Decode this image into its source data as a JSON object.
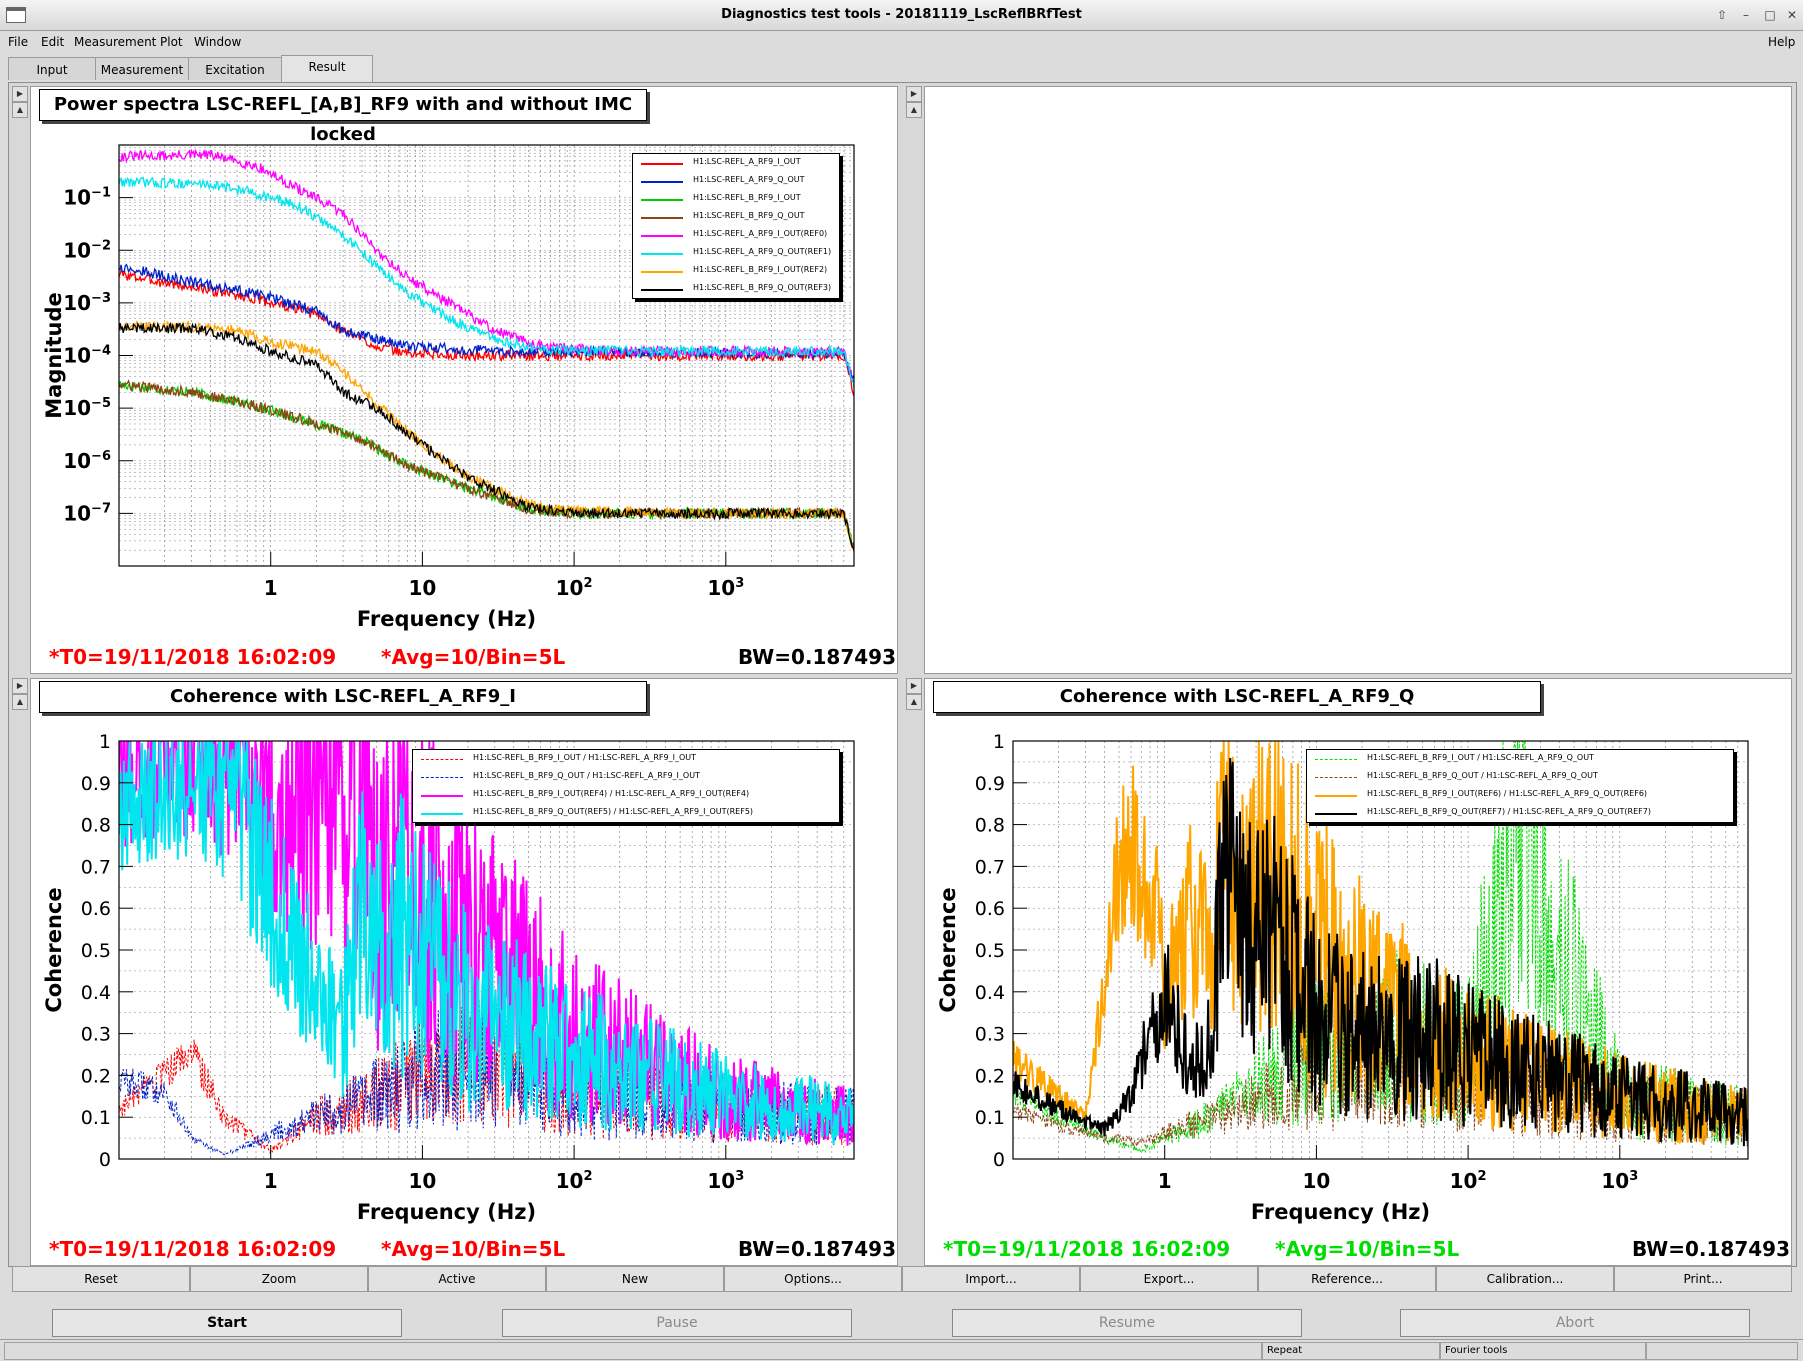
{
  "window": {
    "title": "Diagnostics test tools - 20181119_LscReflBRfTest"
  },
  "menu": {
    "file": "File",
    "edit": "Edit",
    "measurement": "Measurement",
    "plot": "Plot",
    "window": "Window",
    "help": "Help"
  },
  "tabs": [
    "Input",
    "Measurement",
    "Excitation",
    "Result"
  ],
  "active_tab": "Result",
  "pads": {
    "psd": {
      "title": "Power spectra LSC-REFL_[A,B]_RF9 with and without IMC locked",
      "xlabel": "Frequency (Hz)",
      "ylabel": "Magnitude",
      "t0": "*T0=19/11/2018 16:02:09",
      "avg": "*Avg=10/Bin=5L",
      "bw": "BW=0.187493",
      "stat_color": "#ff0000"
    },
    "coh_i": {
      "title": "Coherence with LSC-REFL_A_RF9_I",
      "xlabel": "Frequency (Hz)",
      "ylabel": "Coherence",
      "t0": "*T0=19/11/2018 16:02:09",
      "avg": "*Avg=10/Bin=5L",
      "bw": "BW=0.187493",
      "stat_color": "#ff0000"
    },
    "coh_q": {
      "title": "Coherence with LSC-REFL_A_RF9_Q",
      "xlabel": "Frequency (Hz)",
      "ylabel": "Coherence",
      "t0": "*T0=19/11/2018 16:02:09",
      "avg": "*Avg=10/Bin=5L",
      "bw": "BW=0.187493",
      "stat_color": "#00dd00"
    }
  },
  "chart_data": [
    {
      "type": "line",
      "title": "Power spectra LSC-REFL_[A,B]_RF9 with and without IMC locked",
      "xlabel": "Frequency (Hz)",
      "ylabel": "Magnitude",
      "xscale": "log",
      "yscale": "log",
      "xlim": [
        0.1,
        7000
      ],
      "ylim": [
        1e-08,
        1
      ],
      "xticks": [
        "1",
        "10",
        "10^2",
        "10^3"
      ],
      "yticks": [
        "10^-7",
        "10^-6",
        "10^-5",
        "10^-4",
        "10^-3",
        "10^-2",
        "10^-1"
      ],
      "grid": true,
      "legend_position": "top-right",
      "series": [
        {
          "name": "H1:LSC-REFL_A_RF9_I_OUT",
          "color": "#ff0000",
          "dash": false,
          "x": [
            0.1,
            0.3,
            0.8,
            2,
            3,
            5,
            8,
            20,
            50,
            100,
            1000,
            6000,
            7000
          ],
          "y": [
            0.0035,
            0.002,
            0.0012,
            0.0006,
            0.0003,
            0.00015,
            0.00011,
            0.0001,
            0.0001,
            0.0001,
            0.0001,
            0.0001,
            2e-05
          ]
        },
        {
          "name": "H1:LSC-REFL_A_RF9_Q_OUT",
          "color": "#0022cc",
          "dash": false,
          "x": [
            0.1,
            0.3,
            0.8,
            2,
            3,
            5,
            8,
            20,
            50,
            100,
            1000,
            6000,
            7000
          ],
          "y": [
            0.005,
            0.0025,
            0.0015,
            0.0007,
            0.0003,
            0.0002,
            0.00015,
            0.00013,
            0.00012,
            0.00012,
            0.00011,
            0.00011,
            3e-05
          ]
        },
        {
          "name": "H1:LSC-REFL_B_RF9_I_OUT",
          "color": "#00cc00",
          "dash": false,
          "x": [
            0.1,
            0.3,
            0.8,
            2,
            4,
            8,
            20,
            50,
            100,
            1000,
            6000,
            7000
          ],
          "y": [
            2.8e-05,
            2e-05,
            1.1e-05,
            5e-06,
            2.5e-06,
            8e-07,
            3e-07,
            1.2e-07,
            1e-07,
            1e-07,
            1e-07,
            2e-08
          ]
        },
        {
          "name": "H1:LSC-REFL_B_RF9_Q_OUT",
          "color": "#8b4513",
          "dash": false,
          "x": [
            0.1,
            0.3,
            0.8,
            2,
            4,
            8,
            20,
            50,
            100,
            1000,
            6000,
            7000
          ],
          "y": [
            2.8e-05,
            2e-05,
            1.1e-05,
            5e-06,
            2.5e-06,
            8e-07,
            3e-07,
            1.2e-07,
            1e-07,
            1e-07,
            1e-07,
            2e-08
          ]
        },
        {
          "name": "H1:LSC-REFL_A_RF9_I_OUT(REF0)",
          "color": "#ff00ff",
          "dash": false,
          "x": [
            0.1,
            0.4,
            0.8,
            1.5,
            3,
            5,
            8,
            15,
            30,
            60,
            200,
            1000,
            6000,
            7000
          ],
          "y": [
            0.6,
            0.65,
            0.4,
            0.15,
            0.05,
            0.01,
            0.003,
            0.001,
            0.0003,
            0.00015,
            0.00012,
            0.00012,
            0.00012,
            3e-05
          ]
        },
        {
          "name": "H1:LSC-REFL_A_RF9_Q_OUT(REF1)",
          "color": "#00e5ee",
          "dash": false,
          "x": [
            0.1,
            0.4,
            0.8,
            1.5,
            3,
            5,
            8,
            15,
            30,
            60,
            200,
            1000,
            6000,
            7000
          ],
          "y": [
            0.2,
            0.18,
            0.12,
            0.07,
            0.02,
            0.005,
            0.0015,
            0.0005,
            0.0002,
            0.00013,
            0.00012,
            0.00012,
            0.00012,
            3e-05
          ]
        },
        {
          "name": "H1:LSC-REFL_B_RF9_I_OUT(REF2)",
          "color": "#ffa500",
          "dash": false,
          "x": [
            0.1,
            0.3,
            0.6,
            1,
            2,
            3,
            5,
            10,
            20,
            50,
            100,
            1000,
            6000,
            7000
          ],
          "y": [
            0.00035,
            0.00035,
            0.0003,
            0.00018,
            0.00012,
            5e-05,
            1.2e-05,
            2e-06,
            5e-07,
            1.5e-07,
            1.1e-07,
            1e-07,
            1e-07,
            2e-08
          ]
        },
        {
          "name": "H1:LSC-REFL_B_RF9_Q_OUT(REF3)",
          "color": "#000000",
          "dash": false,
          "x": [
            0.1,
            0.3,
            0.6,
            1,
            2,
            3,
            5,
            10,
            20,
            50,
            100,
            1000,
            6000,
            7000
          ],
          "y": [
            0.00033,
            0.00033,
            0.00022,
            0.00012,
            7e-05,
            2e-05,
            1e-05,
            2e-06,
            5e-07,
            1.3e-07,
            1e-07,
            1e-07,
            1e-07,
            2e-08
          ]
        }
      ]
    },
    {
      "type": "line",
      "title": "Coherence with LSC-REFL_A_RF9_I",
      "xlabel": "Frequency (Hz)",
      "ylabel": "Coherence",
      "xscale": "log",
      "xlim": [
        0.1,
        7000
      ],
      "ylim": [
        0,
        1
      ],
      "yticks": [
        "0",
        "0.1",
        "0.2",
        "0.3",
        "0.4",
        "0.5",
        "0.6",
        "0.7",
        "0.8",
        "0.9",
        "1"
      ],
      "xticks": [
        "1",
        "10",
        "10^2",
        "10^3"
      ],
      "grid": true,
      "legend_position": "top-right",
      "series": [
        {
          "name": "H1:LSC-REFL_B_RF9_I_OUT / H1:LSC-REFL_A_RF9_I_OUT",
          "color": "#ff0000",
          "dash": true,
          "x": [
            0.1,
            0.2,
            0.3,
            0.5,
            1,
            2,
            5,
            10,
            30,
            100,
            1000,
            7000
          ],
          "y": [
            0.12,
            0.2,
            0.26,
            0.1,
            0.02,
            0.1,
            0.15,
            0.2,
            0.25,
            0.15,
            0.12,
            0.1
          ]
        },
        {
          "name": "H1:LSC-REFL_B_RF9_Q_OUT / H1:LSC-REFL_A_RF9_I_OUT",
          "color": "#0022cc",
          "dash": true,
          "x": [
            0.1,
            0.2,
            0.3,
            0.5,
            1,
            2,
            5,
            10,
            30,
            100,
            1000,
            7000
          ],
          "y": [
            0.19,
            0.16,
            0.05,
            0.01,
            0.06,
            0.1,
            0.15,
            0.2,
            0.25,
            0.15,
            0.12,
            0.1
          ]
        },
        {
          "name": "H1:LSC-REFL_B_RF9_I_OUT(REF4) / H1:LSC-REFL_A_RF9_I_OUT(REF4)",
          "color": "#ff00ff",
          "dash": false,
          "x": [
            0.1,
            0.2,
            0.4,
            0.6,
            0.8,
            1,
            1.5,
            2,
            3,
            4,
            5,
            8,
            10,
            20,
            50,
            100,
            1000,
            7000
          ],
          "y": [
            0.92,
            0.93,
            0.97,
            0.96,
            0.9,
            0.85,
            0.8,
            0.9,
            0.75,
            0.95,
            0.6,
            0.8,
            0.7,
            0.5,
            0.4,
            0.3,
            0.15,
            0.1
          ]
        },
        {
          "name": "H1:LSC-REFL_B_RF9_Q_OUT(REF5) / H1:LSC-REFL_A_RF9_I_OUT(REF5)",
          "color": "#00e5ee",
          "dash": false,
          "x": [
            0.1,
            0.2,
            0.4,
            0.6,
            0.8,
            1,
            1.5,
            2,
            3,
            4,
            5,
            8,
            10,
            20,
            50,
            100,
            1000,
            7000
          ],
          "y": [
            0.85,
            0.88,
            0.92,
            0.85,
            0.75,
            0.65,
            0.5,
            0.4,
            0.3,
            0.6,
            0.5,
            0.55,
            0.45,
            0.35,
            0.3,
            0.25,
            0.15,
            0.1
          ]
        }
      ]
    },
    {
      "type": "line",
      "title": "Coherence with LSC-REFL_A_RF9_Q",
      "xlabel": "Frequency (Hz)",
      "ylabel": "Coherence",
      "xscale": "log",
      "xlim": [
        0.1,
        7000
      ],
      "ylim": [
        0,
        1
      ],
      "yticks": [
        "0",
        "0.1",
        "0.2",
        "0.3",
        "0.4",
        "0.5",
        "0.6",
        "0.7",
        "0.8",
        "0.9",
        "1"
      ],
      "xticks": [
        "1",
        "10",
        "10^2",
        "10^3"
      ],
      "grid": true,
      "legend_position": "top-right",
      "series": [
        {
          "name": "H1:LSC-REFL_B_RF9_I_OUT / H1:LSC-REFL_A_RF9_Q_OUT",
          "color": "#00dd00",
          "dash": true,
          "x": [
            0.1,
            0.2,
            0.4,
            0.7,
            1,
            2,
            5,
            10,
            30,
            100,
            200,
            1000,
            7000
          ],
          "y": [
            0.15,
            0.1,
            0.05,
            0.02,
            0.05,
            0.1,
            0.2,
            0.25,
            0.3,
            0.25,
            0.75,
            0.15,
            0.1
          ]
        },
        {
          "name": "H1:LSC-REFL_B_RF9_Q_OUT / H1:LSC-REFL_A_RF9_Q_OUT",
          "color": "#8b4513",
          "dash": true,
          "x": [
            0.1,
            0.2,
            0.4,
            0.7,
            1,
            2,
            5,
            10,
            30,
            100,
            1000,
            7000
          ],
          "y": [
            0.12,
            0.08,
            0.05,
            0.04,
            0.06,
            0.1,
            0.15,
            0.2,
            0.25,
            0.2,
            0.12,
            0.1
          ]
        },
        {
          "name": "H1:LSC-REFL_B_RF9_I_OUT(REF6) / H1:LSC-REFL_A_RF9_Q_OUT(REF6)",
          "color": "#ffa500",
          "dash": false,
          "x": [
            0.1,
            0.2,
            0.3,
            0.5,
            0.6,
            0.7,
            0.8,
            1,
            1.5,
            2,
            2.5,
            3,
            5,
            8,
            10,
            20,
            50,
            100,
            1000,
            7000
          ],
          "y": [
            0.24,
            0.15,
            0.1,
            0.7,
            0.77,
            0.6,
            0.7,
            0.4,
            0.6,
            0.5,
            0.8,
            0.6,
            0.7,
            0.6,
            0.5,
            0.4,
            0.3,
            0.25,
            0.15,
            0.1
          ]
        },
        {
          "name": "H1:LSC-REFL_B_RF9_Q_OUT(REF7) / H1:LSC-REFL_A_RF9_Q_OUT(REF7)",
          "color": "#000000",
          "dash": false,
          "x": [
            0.1,
            0.2,
            0.4,
            0.6,
            0.8,
            1,
            1.5,
            2,
            2.5,
            3,
            4,
            5,
            8,
            10,
            20,
            50,
            100,
            1000,
            7000
          ],
          "y": [
            0.18,
            0.12,
            0.07,
            0.15,
            0.3,
            0.4,
            0.2,
            0.3,
            0.7,
            0.6,
            0.5,
            0.55,
            0.4,
            0.35,
            0.3,
            0.3,
            0.25,
            0.15,
            0.1
          ]
        }
      ]
    }
  ],
  "buttons": [
    "Reset",
    "Zoom",
    "Active",
    "New",
    "Options...",
    "Import...",
    "Export...",
    "Reference...",
    "Calibration...",
    "Print..."
  ],
  "controls": {
    "start": "Start",
    "pause": "Pause",
    "resume": "Resume",
    "abort": "Abort"
  },
  "status": {
    "repeat": "Repeat",
    "fourier": "Fourier tools"
  }
}
